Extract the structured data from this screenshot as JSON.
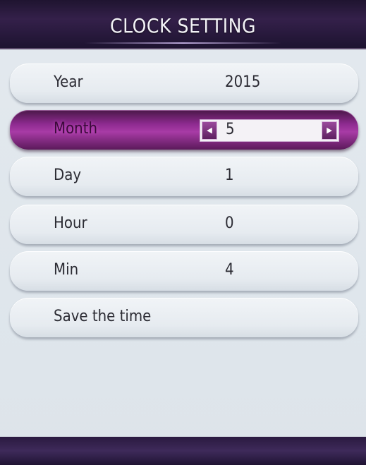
{
  "header": {
    "title": "CLOCK SETTING"
  },
  "rows": [
    {
      "label": "Year",
      "value": "2015"
    },
    {
      "label": "Month",
      "value": "5"
    },
    {
      "label": "Day",
      "value": "1"
    },
    {
      "label": "Hour",
      "value": "0"
    },
    {
      "label": "Min",
      "value": "4"
    },
    {
      "label": "Save the time",
      "value": ""
    }
  ],
  "spinner": {
    "left_icon": "◀",
    "right_icon": "▶"
  },
  "colors": {
    "accent": "#9a3a9a",
    "header": "#2a1a40"
  }
}
